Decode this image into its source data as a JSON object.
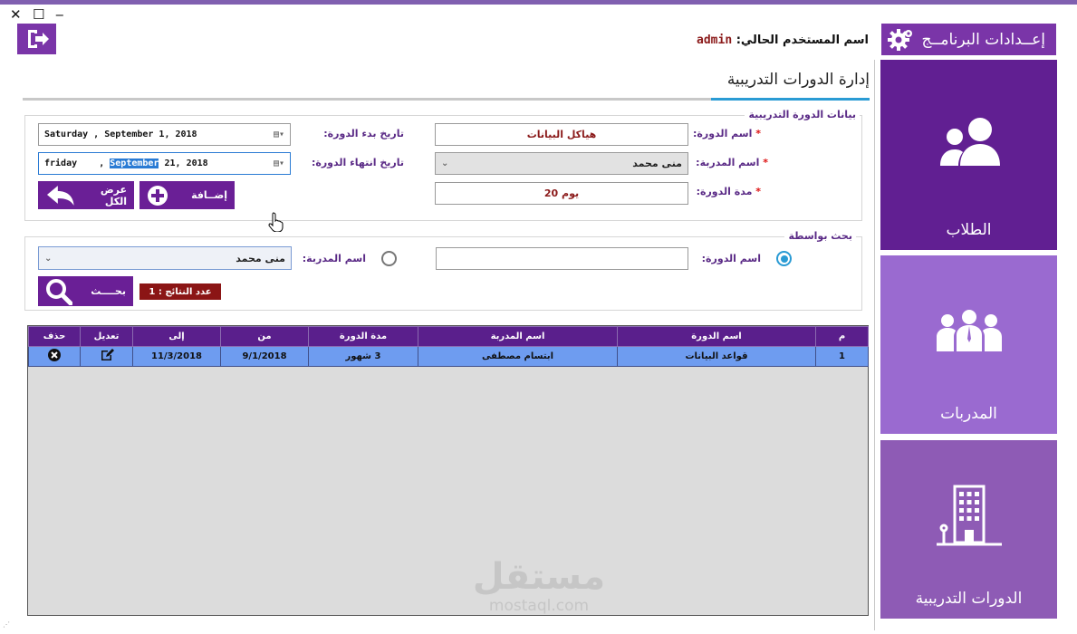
{
  "window": {
    "close_glyph": "✕",
    "maximize_glyph": "☐",
    "minimize_glyph": "‒"
  },
  "header": {
    "user_label": "اسم المستخدم الحالي:",
    "username": "admin",
    "settings_label": "إعــدادات البرنامــج",
    "settings_icon": "gear-icon",
    "logout_icon": "logout-icon"
  },
  "sidebar": {
    "tiles": [
      {
        "label": "الطلاب",
        "icon": "users-icon",
        "color": "#611f92"
      },
      {
        "label": "المدربات",
        "icon": "team-icon",
        "color": "#9a6ad0"
      },
      {
        "label": "الدورات التدريبية",
        "icon": "building-icon",
        "color": "#8e5bb5"
      }
    ]
  },
  "page": {
    "title": "إدارة الدورات التدريبية"
  },
  "course_form": {
    "group_title": "بيانات الدورة التدريبية",
    "course_name_label": "اسم الدورة:",
    "course_name_value": "هياكل البيانات",
    "trainer_label": "اسم المدربة:",
    "trainer_value": "منى محمد",
    "duration_label": "مدة الدورة:",
    "duration_value": "20 يوم",
    "required_mark": "*",
    "start_date_label": "تاريخ بدء الدورة:",
    "start_date_value": "Saturday , September  1, 2018",
    "end_date_label": "تاريخ انتهاء الدورة:",
    "end_date_day": "friday    ,",
    "end_date_month": "September",
    "end_date_rest": "21, 2018",
    "show_all_label": "عرض الكل",
    "add_label": "إضــافة"
  },
  "search": {
    "group_title": "بحث بواسطة",
    "by_course_label": "اسم الدورة:",
    "course_value": "",
    "by_trainer_label": "اسم المدربة:",
    "trainer_value": "منى محمد",
    "search_label": "بحــــث",
    "results_count": "عدد النتائج : 1",
    "selected_option": "course"
  },
  "grid": {
    "columns": [
      "م",
      "اسم الدورة",
      "اسم المدربة",
      "مدة الدورة",
      "من",
      "إلى",
      "تعديل",
      "حذف"
    ],
    "rows": [
      [
        "1",
        "قواعد البيانات",
        "ابتسام مصطفى",
        "3 شهور",
        "9/1/2018",
        "11/3/2018",
        "edit-icon",
        "delete-icon"
      ]
    ]
  },
  "watermark": {
    "line1": "مستقل",
    "line2": "mostaql.com"
  },
  "colors": {
    "accent_purple": "#7a35a8",
    "header_dark": "#5a1f8c",
    "row_blue": "#6e9cf0",
    "tab_accent": "#2a9bd4",
    "badge_red": "#8b1515"
  }
}
